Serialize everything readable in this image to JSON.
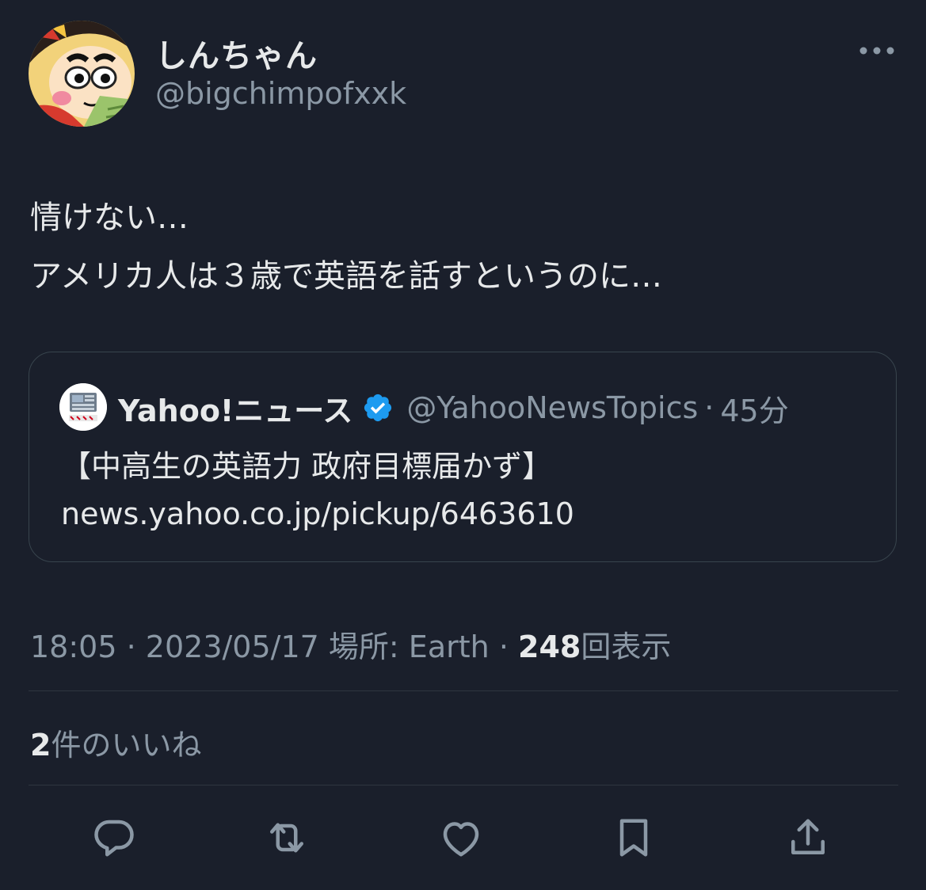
{
  "author": {
    "display_name": "しんちゃん",
    "handle": "@bigchimpofxxk",
    "avatar_icon": "cartoon-boy-avatar"
  },
  "tweet": {
    "lines": [
      "情けない…",
      "アメリカ人は３歳で英語を話すというのに…"
    ]
  },
  "quote": {
    "name": "Yahoo!ニュース",
    "handle": "@YahooNewsTopics",
    "separator": "·",
    "time": "45分",
    "verified_icon": "verified-badge-icon",
    "text_lines": [
      "【中高生の英語力 政府目標届かず】",
      "news.yahoo.co.jp/pickup/6463610"
    ]
  },
  "meta": {
    "time": "18:05",
    "separator": "·",
    "date": "2023/05/17",
    "location": "場所: Earth",
    "views_count": "248",
    "views_label": "回表示"
  },
  "likes": {
    "count": "2",
    "label": "件のいいね"
  },
  "actions": [
    {
      "icon": "reply-icon"
    },
    {
      "icon": "retweet-icon"
    },
    {
      "icon": "like-icon"
    },
    {
      "icon": "bookmark-icon"
    },
    {
      "icon": "share-icon"
    }
  ],
  "colors": {
    "background": "#1a1f2b",
    "text_primary": "#e7e9ea",
    "text_secondary": "#8b98a5",
    "verified": "#1d9bf0",
    "border": "#38444d"
  }
}
